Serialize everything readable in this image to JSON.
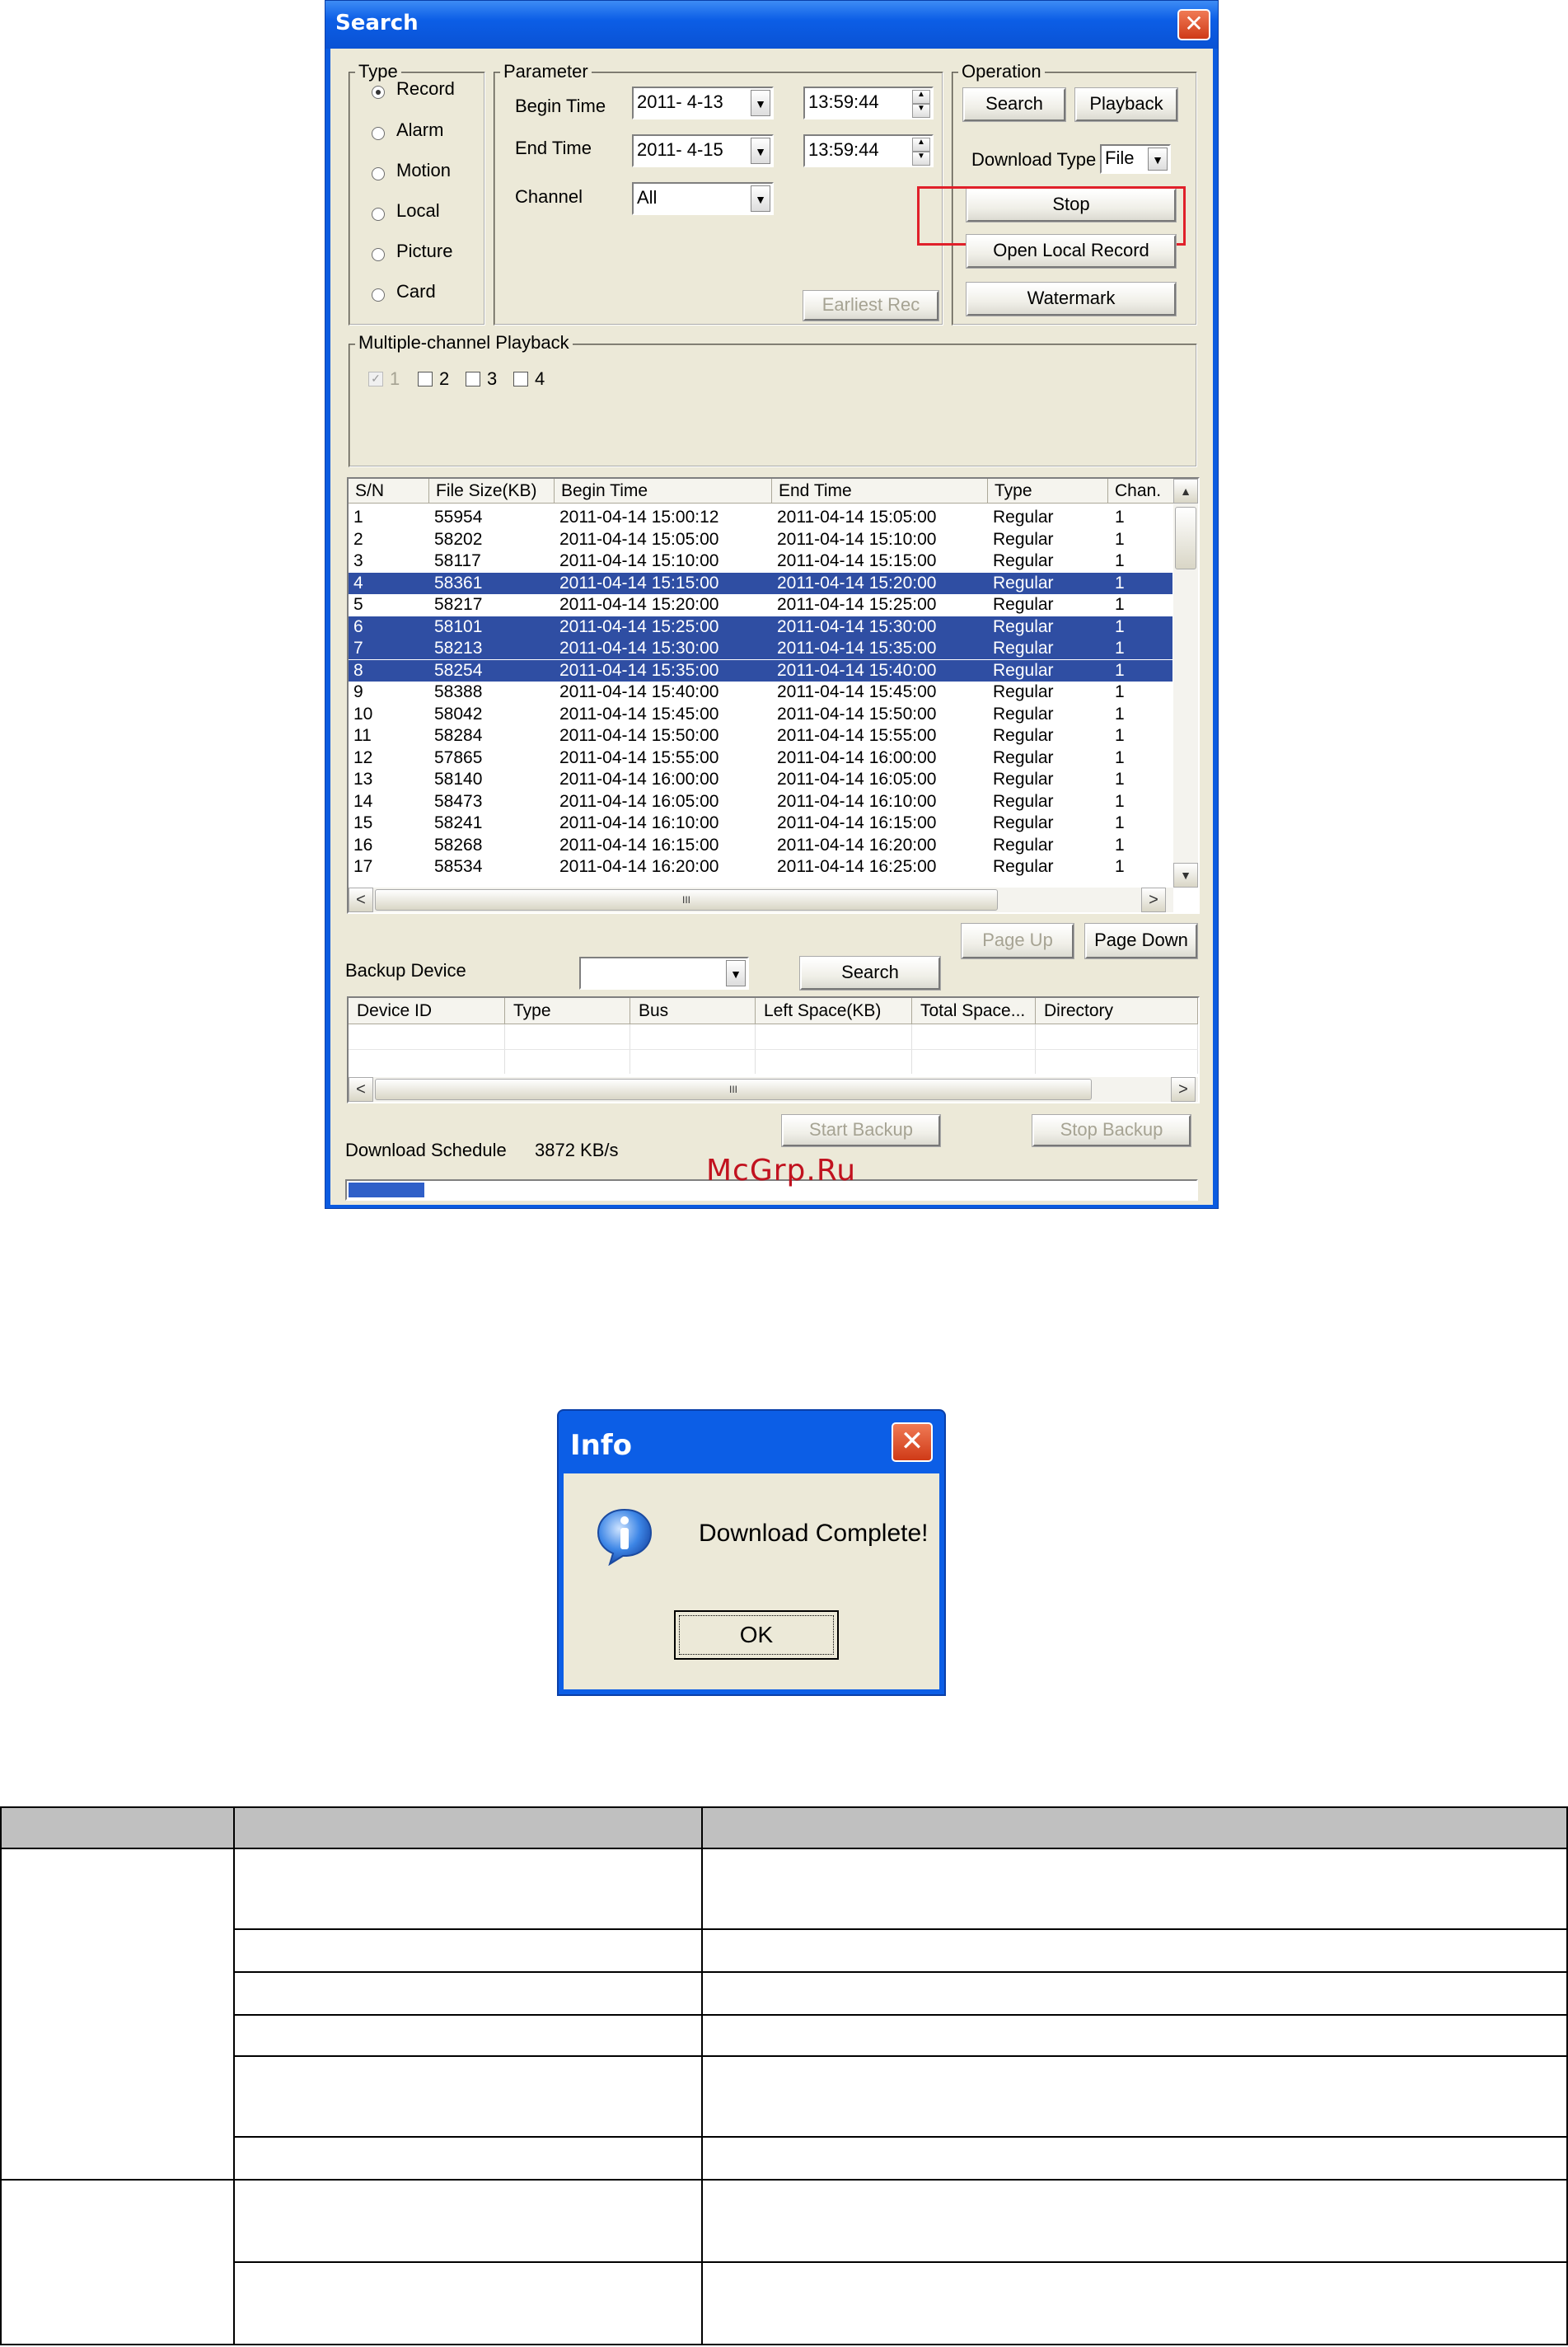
{
  "window": {
    "title": "Search",
    "close_glyph": "✕"
  },
  "type_group": {
    "label": "Type",
    "options": [
      {
        "label": "Record",
        "selected": true
      },
      {
        "label": "Alarm",
        "selected": false
      },
      {
        "label": "Motion",
        "selected": false
      },
      {
        "label": "Local",
        "selected": false
      },
      {
        "label": "Picture",
        "selected": false
      },
      {
        "label": "Card",
        "selected": false
      }
    ]
  },
  "parameter": {
    "label": "Parameter",
    "begin_time_label": "Begin Time",
    "begin_date": "2011- 4-13",
    "begin_clock": "13:59:44",
    "end_time_label": "End Time",
    "end_date": "2011- 4-15",
    "end_clock": "13:59:44",
    "channel_label": "Channel",
    "channel_value": "All",
    "earliest_rec": "Earliest Rec"
  },
  "operation": {
    "label": "Operation",
    "search": "Search",
    "playback": "Playback",
    "download_type_label": "Download Type",
    "download_type_value": "File",
    "stop": "Stop",
    "open_local_record": "Open Local Record",
    "watermark": "Watermark",
    "highlight_color": "#e0202a"
  },
  "multi_channel": {
    "label": "Multiple-channel Playback",
    "channels": [
      {
        "label": "1",
        "checked": true,
        "disabled": true
      },
      {
        "label": "2",
        "checked": false,
        "disabled": false
      },
      {
        "label": "3",
        "checked": false,
        "disabled": false
      },
      {
        "label": "4",
        "checked": false,
        "disabled": false
      }
    ]
  },
  "file_list": {
    "columns": [
      "S/N",
      "File Size(KB)",
      "Begin Time",
      "End Time",
      "Type",
      "Chan."
    ],
    "selection_color": "#2f4ea3",
    "rows": [
      {
        "sn": "1",
        "size": "55954",
        "begin": "2011-04-14 15:00:12",
        "end": "2011-04-14 15:05:00",
        "type": "Regular",
        "chan": "1",
        "selected": false
      },
      {
        "sn": "2",
        "size": "58202",
        "begin": "2011-04-14 15:05:00",
        "end": "2011-04-14 15:10:00",
        "type": "Regular",
        "chan": "1",
        "selected": false
      },
      {
        "sn": "3",
        "size": "58117",
        "begin": "2011-04-14 15:10:00",
        "end": "2011-04-14 15:15:00",
        "type": "Regular",
        "chan": "1",
        "selected": false
      },
      {
        "sn": "4",
        "size": "58361",
        "begin": "2011-04-14 15:15:00",
        "end": "2011-04-14 15:20:00",
        "type": "Regular",
        "chan": "1",
        "selected": true
      },
      {
        "sn": "5",
        "size": "58217",
        "begin": "2011-04-14 15:20:00",
        "end": "2011-04-14 15:25:00",
        "type": "Regular",
        "chan": "1",
        "selected": false
      },
      {
        "sn": "6",
        "size": "58101",
        "begin": "2011-04-14 15:25:00",
        "end": "2011-04-14 15:30:00",
        "type": "Regular",
        "chan": "1",
        "selected": true
      },
      {
        "sn": "7",
        "size": "58213",
        "begin": "2011-04-14 15:30:00",
        "end": "2011-04-14 15:35:00",
        "type": "Regular",
        "chan": "1",
        "selected": true
      },
      {
        "sn": "8",
        "size": "58254",
        "begin": "2011-04-14 15:35:00",
        "end": "2011-04-14 15:40:00",
        "type": "Regular",
        "chan": "1",
        "selected": true
      },
      {
        "sn": "9",
        "size": "58388",
        "begin": "2011-04-14 15:40:00",
        "end": "2011-04-14 15:45:00",
        "type": "Regular",
        "chan": "1",
        "selected": false
      },
      {
        "sn": "10",
        "size": "58042",
        "begin": "2011-04-14 15:45:00",
        "end": "2011-04-14 15:50:00",
        "type": "Regular",
        "chan": "1",
        "selected": false
      },
      {
        "sn": "11",
        "size": "58284",
        "begin": "2011-04-14 15:50:00",
        "end": "2011-04-14 15:55:00",
        "type": "Regular",
        "chan": "1",
        "selected": false
      },
      {
        "sn": "12",
        "size": "57865",
        "begin": "2011-04-14 15:55:00",
        "end": "2011-04-14 16:00:00",
        "type": "Regular",
        "chan": "1",
        "selected": false
      },
      {
        "sn": "13",
        "size": "58140",
        "begin": "2011-04-14 16:00:00",
        "end": "2011-04-14 16:05:00",
        "type": "Regular",
        "chan": "1",
        "selected": false
      },
      {
        "sn": "14",
        "size": "58473",
        "begin": "2011-04-14 16:05:00",
        "end": "2011-04-14 16:10:00",
        "type": "Regular",
        "chan": "1",
        "selected": false
      },
      {
        "sn": "15",
        "size": "58241",
        "begin": "2011-04-14 16:10:00",
        "end": "2011-04-14 16:15:00",
        "type": "Regular",
        "chan": "1",
        "selected": false
      },
      {
        "sn": "16",
        "size": "58268",
        "begin": "2011-04-14 16:15:00",
        "end": "2011-04-14 16:20:00",
        "type": "Regular",
        "chan": "1",
        "selected": false
      },
      {
        "sn": "17",
        "size": "58534",
        "begin": "2011-04-14 16:20:00",
        "end": "2011-04-14 16:25:00",
        "type": "Regular",
        "chan": "1",
        "selected": false
      }
    ],
    "page_up": "Page Up",
    "page_down": "Page Down",
    "scroll_left": "<",
    "scroll_right": ">",
    "scroll_up": "▲",
    "scroll_down": "▼",
    "scroll_grip": "III"
  },
  "backup": {
    "device_label": "Backup Device",
    "device_value": "",
    "search": "Search",
    "columns": [
      "Device ID",
      "Type",
      "Bus",
      "Left Space(KB)",
      "Total Space...",
      "Directory"
    ],
    "start_backup": "Start Backup",
    "stop_backup": "Stop Backup",
    "schedule_label": "Download Schedule",
    "speed": "3872 KB/s",
    "progress": 0.09,
    "progress_color": "#2f5fc8"
  },
  "watermark_text": "McGrp.Ru",
  "info_dialog": {
    "title": "Info",
    "close_glyph": "✕",
    "message": "Download Complete!",
    "ok": "OK",
    "icon": "info-icon"
  }
}
